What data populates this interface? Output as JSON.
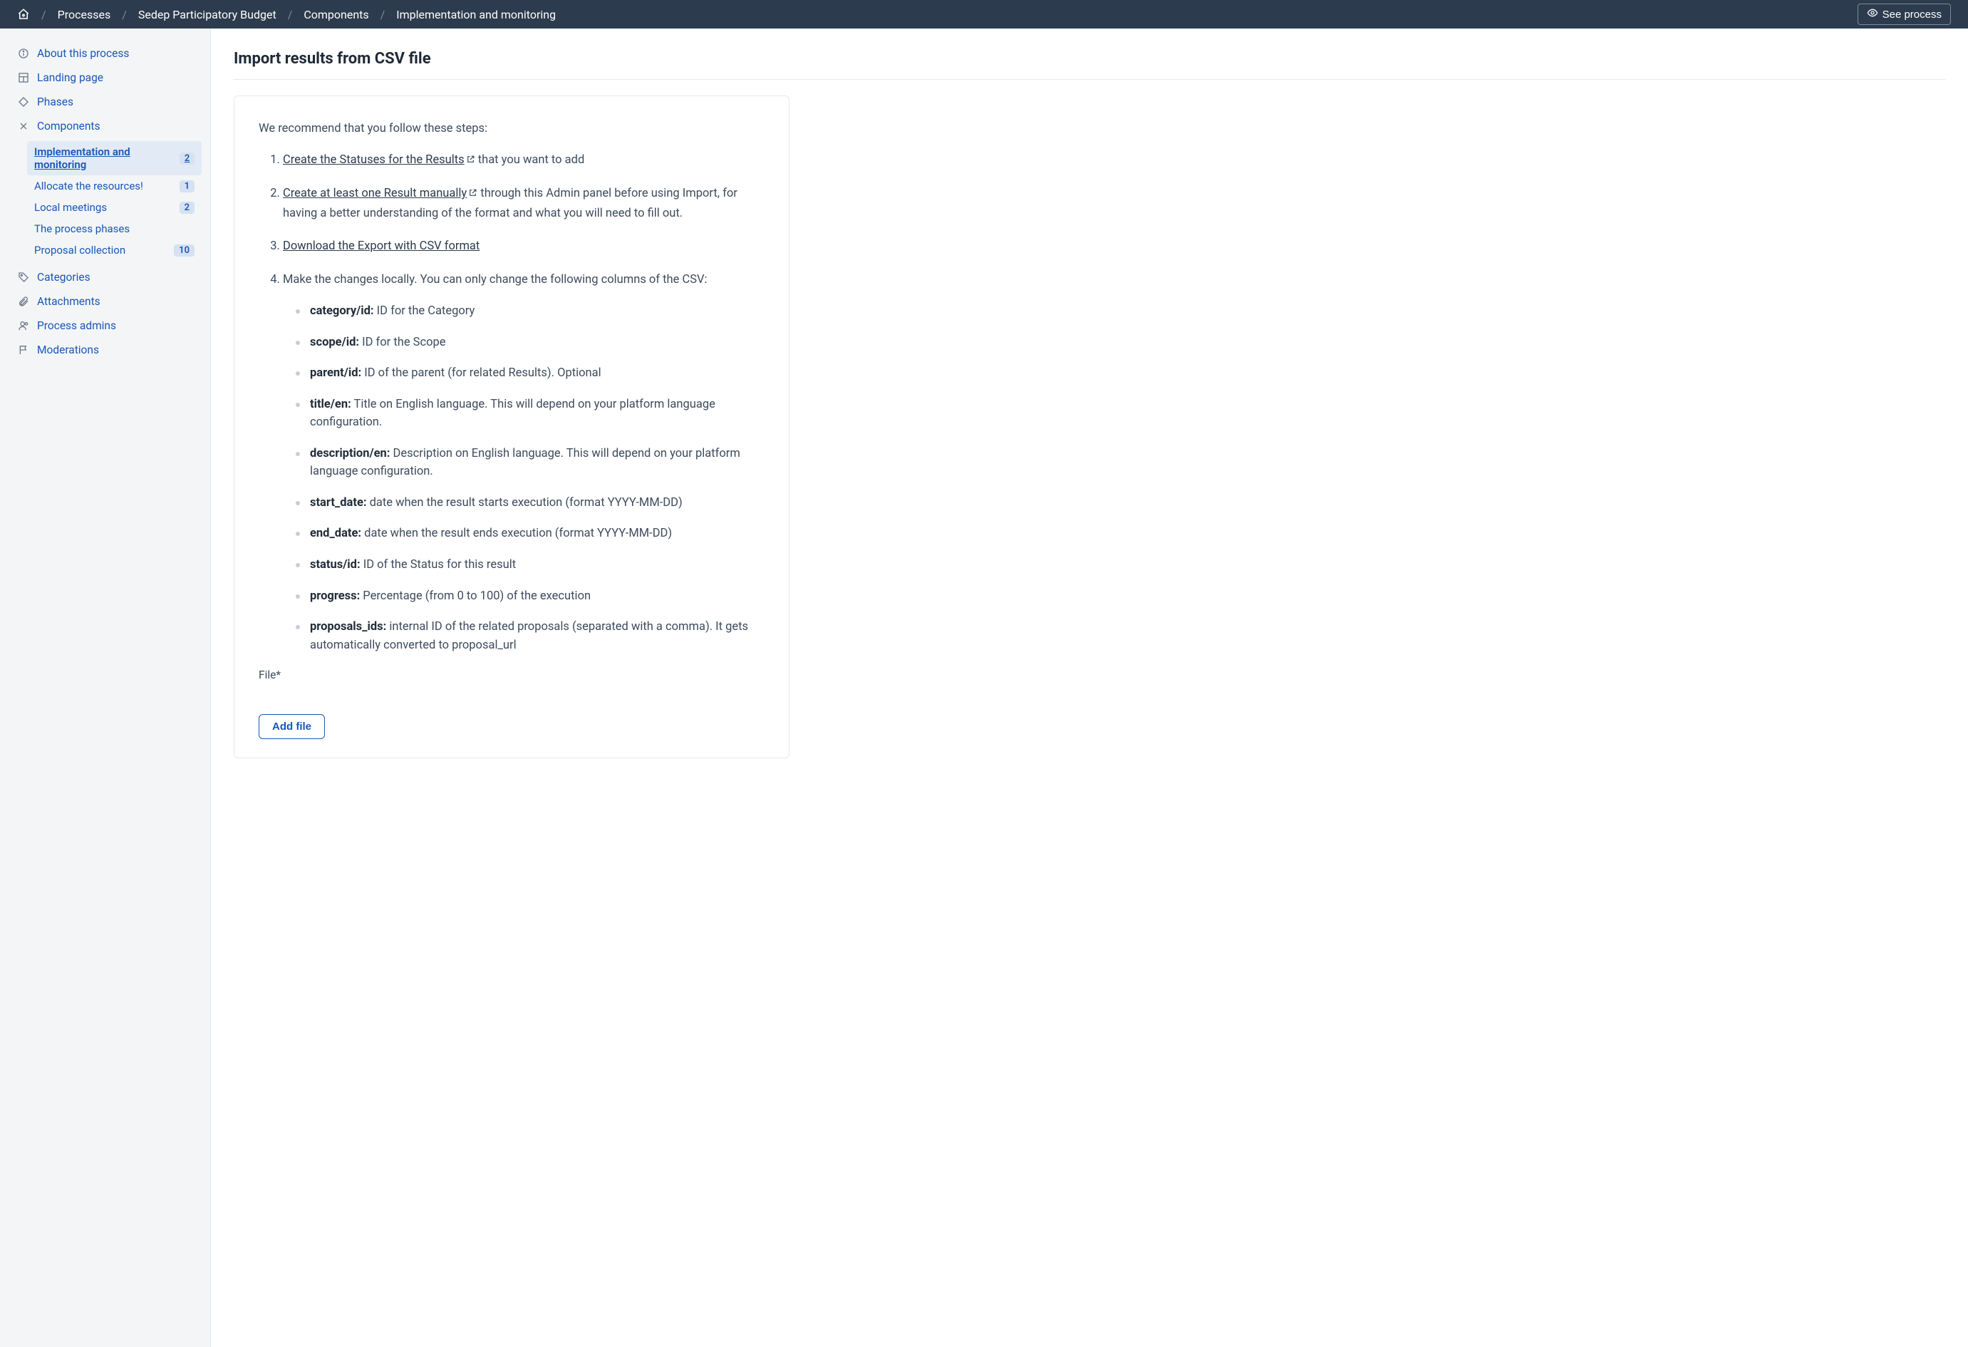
{
  "header": {
    "breadcrumb": [
      "Processes",
      "Sedep Participatory Budget",
      "Components",
      "Implementation and monitoring"
    ],
    "see_process_label": "See process"
  },
  "sidebar": {
    "items": [
      {
        "icon": "info",
        "label": "About this process"
      },
      {
        "icon": "grid",
        "label": "Landing page"
      },
      {
        "icon": "diamond",
        "label": "Phases"
      },
      {
        "icon": "tools",
        "label": "Components"
      },
      {
        "icon": "tag",
        "label": "Categories"
      },
      {
        "icon": "clip",
        "label": "Attachments"
      },
      {
        "icon": "user",
        "label": "Process admins"
      },
      {
        "icon": "flag",
        "label": "Moderations"
      }
    ],
    "components": [
      {
        "label": "Implementation and monitoring",
        "count": "2",
        "active": true
      },
      {
        "label": "Allocate the resources!",
        "count": "1"
      },
      {
        "label": "Local meetings",
        "count": "2"
      },
      {
        "label": "The process phases",
        "count": ""
      },
      {
        "label": "Proposal collection",
        "count": "10"
      }
    ]
  },
  "main": {
    "title": "Import results from CSV file",
    "intro": "We recommend that you follow these steps:",
    "step1_link": "Create the Statuses for the Results",
    "step1_tail": " that you want to add",
    "step2_link": "Create at least one Result manually",
    "step2_tail": " through this Admin panel before using Import, for having a better understanding of the format and what you will need to fill out.",
    "step3_link": "Download the Export with CSV format",
    "step4_text": "Make the changes locally. You can only change the following columns of the CSV:",
    "fields": [
      {
        "k": "category/id:",
        "v": " ID for the Category"
      },
      {
        "k": "scope/id:",
        "v": " ID for the Scope"
      },
      {
        "k": "parent/id:",
        "v": " ID of the parent (for related Results). Optional"
      },
      {
        "k": "title/en:",
        "v": " Title on English language. This will depend on your platform language configuration."
      },
      {
        "k": "description/en:",
        "v": " Description on English language. This will depend on your platform language configuration."
      },
      {
        "k": "start_date:",
        "v": " date when the result starts execution (format YYYY-MM-DD)"
      },
      {
        "k": "end_date:",
        "v": " date when the result ends execution (format YYYY-MM-DD)"
      },
      {
        "k": "status/id:",
        "v": " ID of the Status for this result"
      },
      {
        "k": "progress:",
        "v": " Percentage (from 0 to 100) of the execution"
      },
      {
        "k": "proposals_ids:",
        "v": " internal ID of the related proposals (separated with a comma). It gets automatically converted to proposal_url"
      }
    ],
    "file_label": "File*",
    "add_file_label": "Add file"
  }
}
